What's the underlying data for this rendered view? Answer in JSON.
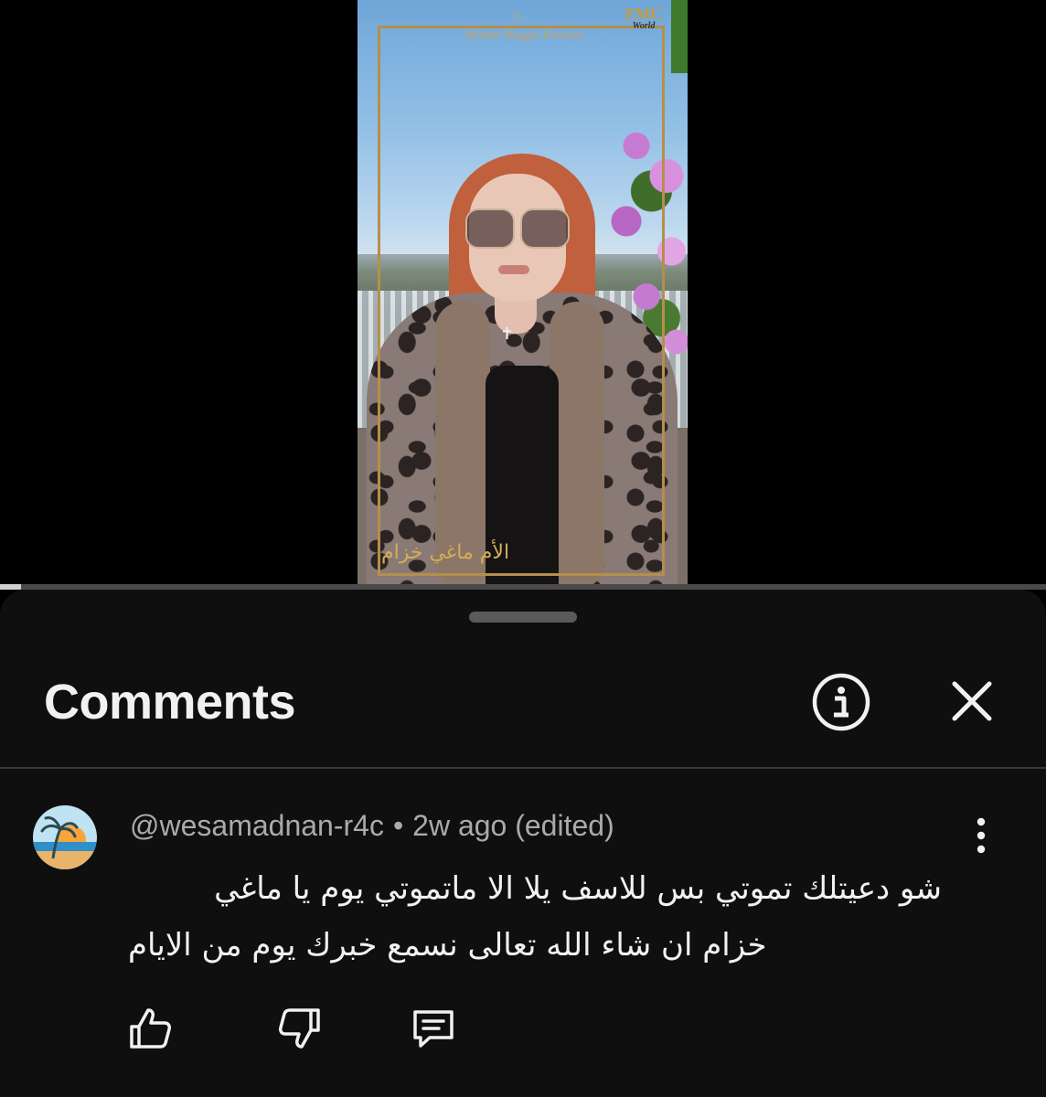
{
  "video": {
    "brand_text": "Mother Maggie Khozam",
    "channel_logo": "FMC",
    "channel_logo_sub": "World",
    "overlay_name": "الأم ماغي خزام",
    "progress": 0.02
  },
  "comments_panel": {
    "title": "Comments",
    "icons": {
      "info": "info-icon",
      "close": "close-icon"
    }
  },
  "comment": {
    "author": "@wesamadnan-r4c",
    "separator": "•",
    "time": "2w ago (edited)",
    "lines": [
      "شو دعيتلك تموتي بس للاسف يلا الا ماتموتي يوم يا ماغي",
      "خزام  ان شاء الله تعالى نسمع خبرك يوم من الايام"
    ],
    "actions": [
      "thumbs-up-icon",
      "thumbs-down-icon",
      "reply-icon"
    ],
    "menu_icon": "more-vertical-icon"
  },
  "colors": {
    "sheet_bg": "#0f0f0f",
    "text_primary": "#f1f1f1",
    "text_secondary": "#aaaaaa",
    "gold": "#b58f4a"
  }
}
